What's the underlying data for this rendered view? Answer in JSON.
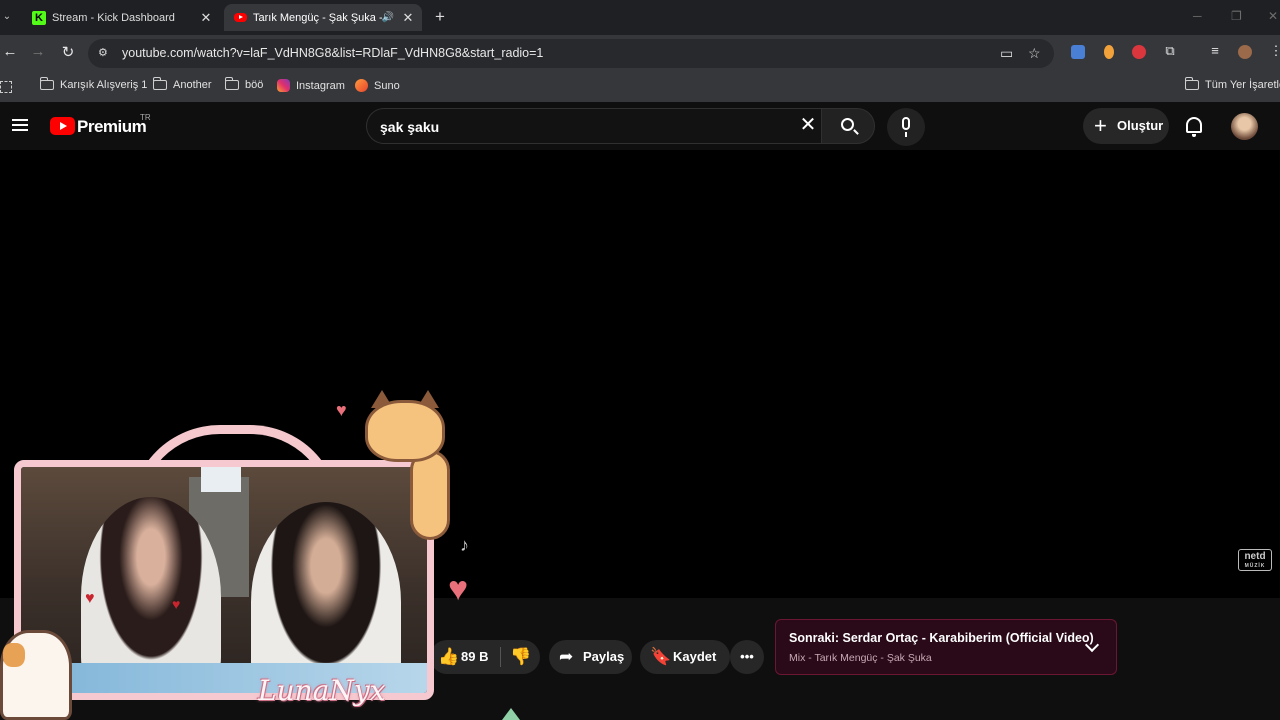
{
  "browser": {
    "tabs": [
      {
        "title": "Stream - Kick Dashboard",
        "favicon": "kick-icon",
        "active": false
      },
      {
        "title": "Tarık Mengüç - Şak Şuka - Y",
        "favicon": "youtube-icon",
        "active": true
      }
    ],
    "new_tab_label": "+",
    "url": "youtube.com/watch?v=laF_VdHN8G8&list=RDlaF_VdHN8G8&start_radio=1",
    "bookmarks": [
      {
        "label": "Karışık Alışveriş 1",
        "icon": "folder-icon"
      },
      {
        "label": "Another",
        "icon": "folder-icon"
      },
      {
        "label": "böö",
        "icon": "folder-icon"
      },
      {
        "label": "Instagram",
        "icon": "instagram-icon"
      },
      {
        "label": "Suno",
        "icon": "suno-icon"
      }
    ],
    "all_bookmarks": "Tüm Yer İşaretleri"
  },
  "youtube": {
    "brand": "Premium",
    "region": "TR",
    "search_value": "şak şaku",
    "create_label": "Oluştur",
    "actions": {
      "likes": "89 B",
      "share": "Paylaş",
      "save": "Kaydet"
    },
    "next": {
      "title": "Sonraki: Serdar Ortaç - Karabiberim (Official Video)",
      "subtitle": "Mix - Tarık Mengüç - Şak Şuka"
    },
    "watermark": "netd",
    "watermark_sub": "MÜZİK"
  },
  "overlay": {
    "name": "LunaNyx"
  },
  "colors": {
    "youtube_red": "#ff0000",
    "kick_green": "#53fc18",
    "overlay_pink": "#f5c9cf",
    "next_card_bg": "#2a0a18"
  }
}
